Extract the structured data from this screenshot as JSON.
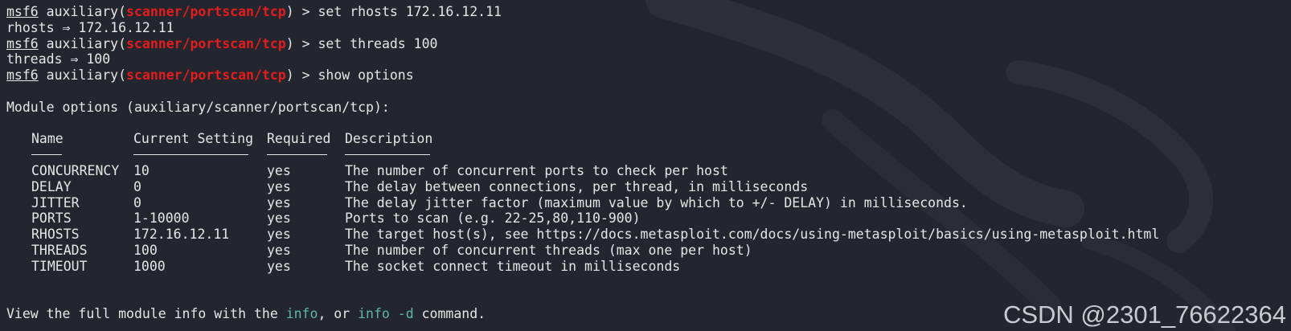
{
  "commands": [
    {
      "prompt": "msf6",
      "context_pre": " auxiliary(",
      "module": "scanner/portscan/tcp",
      "context_post": ") > ",
      "input": "set rhosts 172.16.12.11",
      "output": "rhosts ⇒ 172.16.12.11"
    },
    {
      "prompt": "msf6",
      "context_pre": " auxiliary(",
      "module": "scanner/portscan/tcp",
      "context_post": ") > ",
      "input": "set threads 100",
      "output": "threads ⇒ 100"
    },
    {
      "prompt": "msf6",
      "context_pre": " auxiliary(",
      "module": "scanner/portscan/tcp",
      "context_post": ") > ",
      "input": "show options"
    }
  ],
  "options": {
    "heading": "Module options (auxiliary/scanner/portscan/tcp):",
    "columns": [
      "Name",
      "Current Setting",
      "Required",
      "Description"
    ],
    "rows": [
      [
        "CONCURRENCY",
        "10",
        "yes",
        "The number of concurrent ports to check per host"
      ],
      [
        "DELAY",
        "0",
        "yes",
        "The delay between connections, per thread, in milliseconds"
      ],
      [
        "JITTER",
        "0",
        "yes",
        "The delay jitter factor (maximum value by which to +/- DELAY) in milliseconds."
      ],
      [
        "PORTS",
        "1-10000",
        "yes",
        "Ports to scan (e.g. 22-25,80,110-900)"
      ],
      [
        "RHOSTS",
        "172.16.12.11",
        "yes",
        "The target host(s), see https://docs.metasploit.com/docs/using-metasploit/basics/using-metasploit.html"
      ],
      [
        "THREADS",
        "100",
        "yes",
        "The number of concurrent threads (max one per host)"
      ],
      [
        "TIMEOUT",
        "1000",
        "yes",
        "The socket connect timeout in milliseconds"
      ]
    ]
  },
  "footer": {
    "pre": "View the full module info with the ",
    "link1": "info",
    "mid": ", or ",
    "link2": "info -d",
    "post": " command."
  },
  "watermark": "CSDN @2301_76622364",
  "colors": {
    "background": "#23262e",
    "module": "#e31d1d",
    "link": "#5cb8a3",
    "text": "#e6e6e6"
  }
}
